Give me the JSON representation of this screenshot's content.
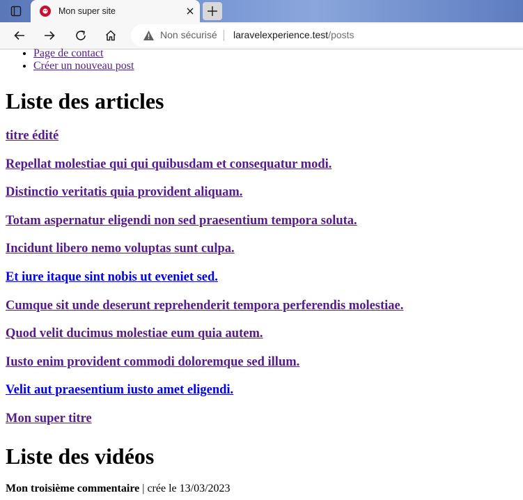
{
  "browser": {
    "tab_title": "Mon super site",
    "security_label": "Non sécurisé",
    "url_host": "laravelexperience.test",
    "url_path": "/posts"
  },
  "nav": [
    {
      "label": "Page de contact"
    },
    {
      "label": "Créer un nouveau post"
    }
  ],
  "articles_heading": "Liste des articles",
  "articles": [
    {
      "title": "titre édité",
      "visited": true
    },
    {
      "title": "Repellat molestiae qui qui quibusdam et consequatur modi.",
      "visited": true
    },
    {
      "title": "Distinctio veritatis quia provident aliquam.",
      "visited": true
    },
    {
      "title": "Totam aspernatur eligendi non sed praesentium tempora soluta.",
      "visited": true
    },
    {
      "title": "Incidunt libero nemo voluptas sunt culpa.",
      "visited": true
    },
    {
      "title": "Et iure itaque sint nobis ut eveniet sed.",
      "visited": false
    },
    {
      "title": "Cumque sit unde deserunt reprehenderit tempora perferendis molestiae.",
      "visited": true
    },
    {
      "title": "Quod velit ducimus molestiae eum quia autem.",
      "visited": true
    },
    {
      "title": "Iusto enim provident commodi doloremque sed illum.",
      "visited": true
    },
    {
      "title": "Velit aut praesentium iusto amet eligendi.",
      "visited": false
    },
    {
      "title": "Mon super titre",
      "visited": true
    }
  ],
  "videos_heading": "Liste des vidéos",
  "comment": {
    "title": "Mon troisième commentaire",
    "separator": " | ",
    "meta": "crée le 13/03/2023"
  }
}
